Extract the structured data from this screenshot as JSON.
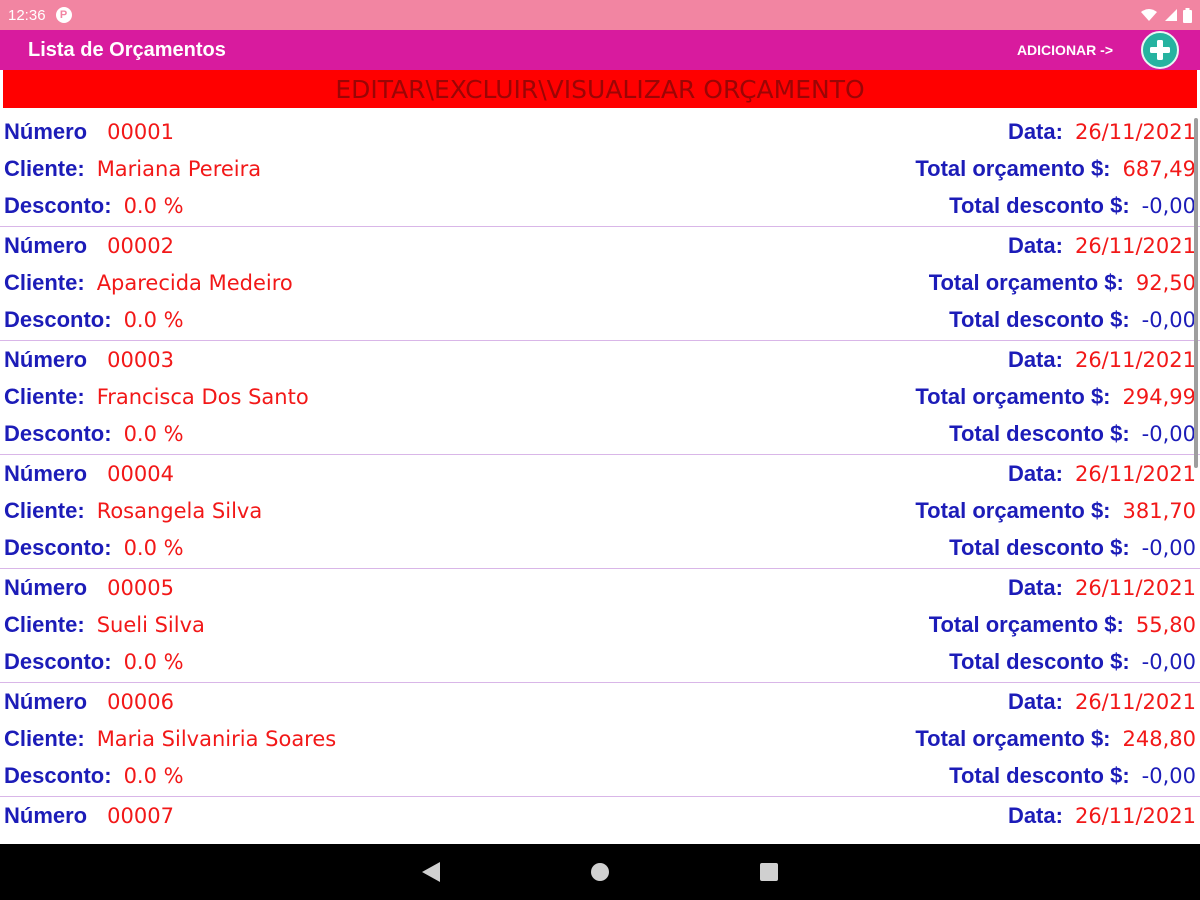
{
  "status_bar": {
    "time": "12:36",
    "app_icon_letter": "P"
  },
  "app_bar": {
    "title": "Lista de Orçamentos",
    "add_label": "ADICIONAR ->",
    "add_icon": "plus-icon"
  },
  "banner": {
    "text": "EDITAR\\EXCLUIR\\VISUALIZAR ORÇAMENTO"
  },
  "labels": {
    "numero": "Número",
    "data": "Data:",
    "cliente": "Cliente:",
    "total_orcamento": "Total orçamento $:",
    "desconto": "Desconto:",
    "total_desconto": "Total desconto $:"
  },
  "items": [
    {
      "numero": "00001",
      "data": "26/11/2021",
      "cliente": "Mariana Pereira",
      "total": "687,49",
      "desconto": "0.0 %",
      "total_desconto": "-0,00"
    },
    {
      "numero": "00002",
      "data": "26/11/2021",
      "cliente": "Aparecida Medeiro",
      "total": "92,50",
      "desconto": "0.0 %",
      "total_desconto": "-0,00"
    },
    {
      "numero": "00003",
      "data": "26/11/2021",
      "cliente": "Francisca Dos Santo",
      "total": "294,99",
      "desconto": "0.0 %",
      "total_desconto": "-0,00"
    },
    {
      "numero": "00004",
      "data": "26/11/2021",
      "cliente": "Rosangela Silva",
      "total": "381,70",
      "desconto": "0.0 %",
      "total_desconto": "-0,00"
    },
    {
      "numero": "00005",
      "data": "26/11/2021",
      "cliente": "Sueli Silva",
      "total": "55,80",
      "desconto": "0.0 %",
      "total_desconto": "-0,00"
    },
    {
      "numero": "00006",
      "data": "26/11/2021",
      "cliente": "Maria Silvaniria Soares",
      "total": "248,80",
      "desconto": "0.0 %",
      "total_desconto": "-0,00"
    },
    {
      "numero": "00007",
      "data": "26/11/2021",
      "cliente": "",
      "total": "",
      "desconto": "",
      "total_desconto": ""
    }
  ],
  "nav_bar": {
    "back_icon": "back-triangle-icon",
    "home_icon": "home-circle-icon",
    "recents_icon": "recents-square-icon"
  },
  "colors": {
    "status_bar": "#f285a2",
    "app_bar": "#d81b9e",
    "banner": "#ff0000",
    "label_blue": "#1c1cb8",
    "value_red": "#f21818",
    "add_button": "#26b3a0"
  }
}
